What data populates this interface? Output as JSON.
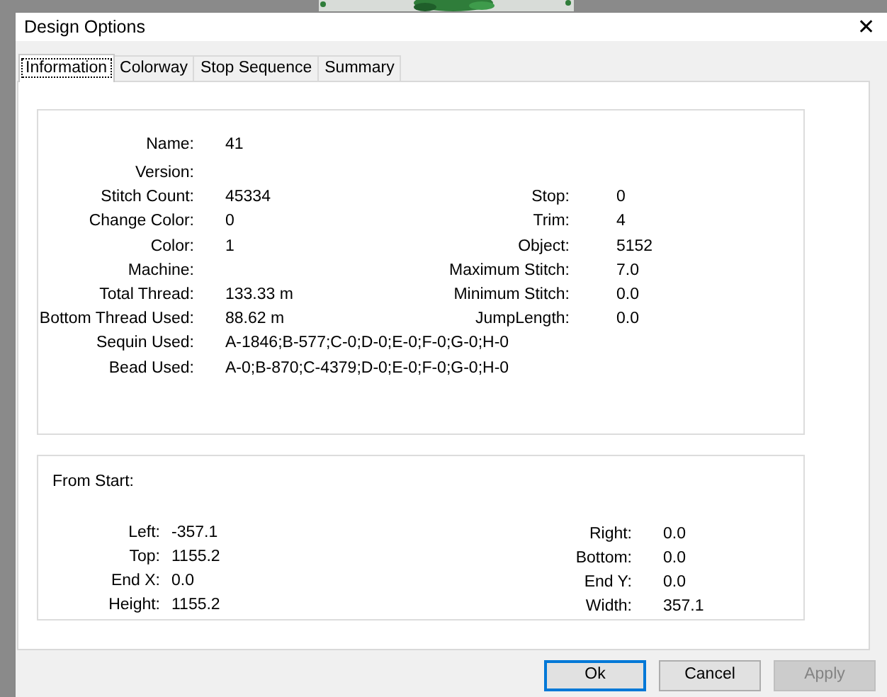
{
  "window": {
    "title": "Design Options",
    "close": "✕"
  },
  "tabs": [
    {
      "label": "Information",
      "selected": true
    },
    {
      "label": "Colorway",
      "selected": false
    },
    {
      "label": "Stop Sequence",
      "selected": false
    },
    {
      "label": "Summary",
      "selected": false
    }
  ],
  "information": {
    "rows": [
      {
        "fields": [
          {
            "label": "Name:",
            "value": "41"
          }
        ]
      },
      {
        "fields": [
          {
            "label": "Version:"
          }
        ]
      },
      {
        "fields": [
          {
            "label": "Stitch Count:",
            "value": "45334"
          },
          {
            "label": "Stop:",
            "value": "0"
          }
        ]
      },
      {
        "fields": [
          {
            "label": "Change Color:",
            "value": "0"
          },
          {
            "label": "Trim:",
            "value": "4"
          }
        ]
      },
      {
        "fields": [
          {
            "label": "Color:",
            "value": "1"
          },
          {
            "label": "Object:",
            "value": "5152"
          }
        ]
      },
      {
        "fields": [
          {
            "label": "Machine:"
          },
          {
            "label": "Maximum Stitch:",
            "value": "7.0"
          }
        ]
      },
      {
        "fields": [
          {
            "label": "Total Thread:",
            "value": "133.33 m"
          },
          {
            "label": "Minimum Stitch:",
            "value": "0.0"
          }
        ]
      },
      {
        "fields": [
          {
            "label": "Bottom Thread Used:",
            "value": "88.62 m"
          },
          {
            "label": "JumpLength:",
            "value": "0.0"
          }
        ]
      },
      {
        "fields": [
          {
            "label": "Sequin Used:",
            "value": "A-1846;B-577;C-0;D-0;E-0;F-0;G-0;H-0"
          }
        ]
      },
      {
        "fields": [
          {
            "label": "Bead Used:",
            "value": "A-0;B-870;C-4379;D-0;E-0;F-0;G-0;H-0"
          }
        ]
      }
    ]
  },
  "from_start": {
    "title": "From Start:",
    "left": [
      {
        "label": "Left:",
        "value": "-357.1"
      },
      {
        "label": "Top:",
        "value": "1155.2"
      },
      {
        "label": "End X:",
        "value": "0.0"
      },
      {
        "label": "Height:",
        "value": "1155.2"
      }
    ],
    "right": [
      {
        "label": "Right:",
        "value": "0.0"
      },
      {
        "label": "Bottom:",
        "value": "0.0"
      },
      {
        "label": "End Y:",
        "value": "0.0"
      },
      {
        "label": "Width:",
        "value": "357.1"
      }
    ]
  },
  "buttons": [
    {
      "label": "Ok",
      "default": true,
      "disabled": false
    },
    {
      "label": "Cancel",
      "default": false,
      "disabled": false
    },
    {
      "label": "Apply",
      "default": false,
      "disabled": true
    }
  ]
}
